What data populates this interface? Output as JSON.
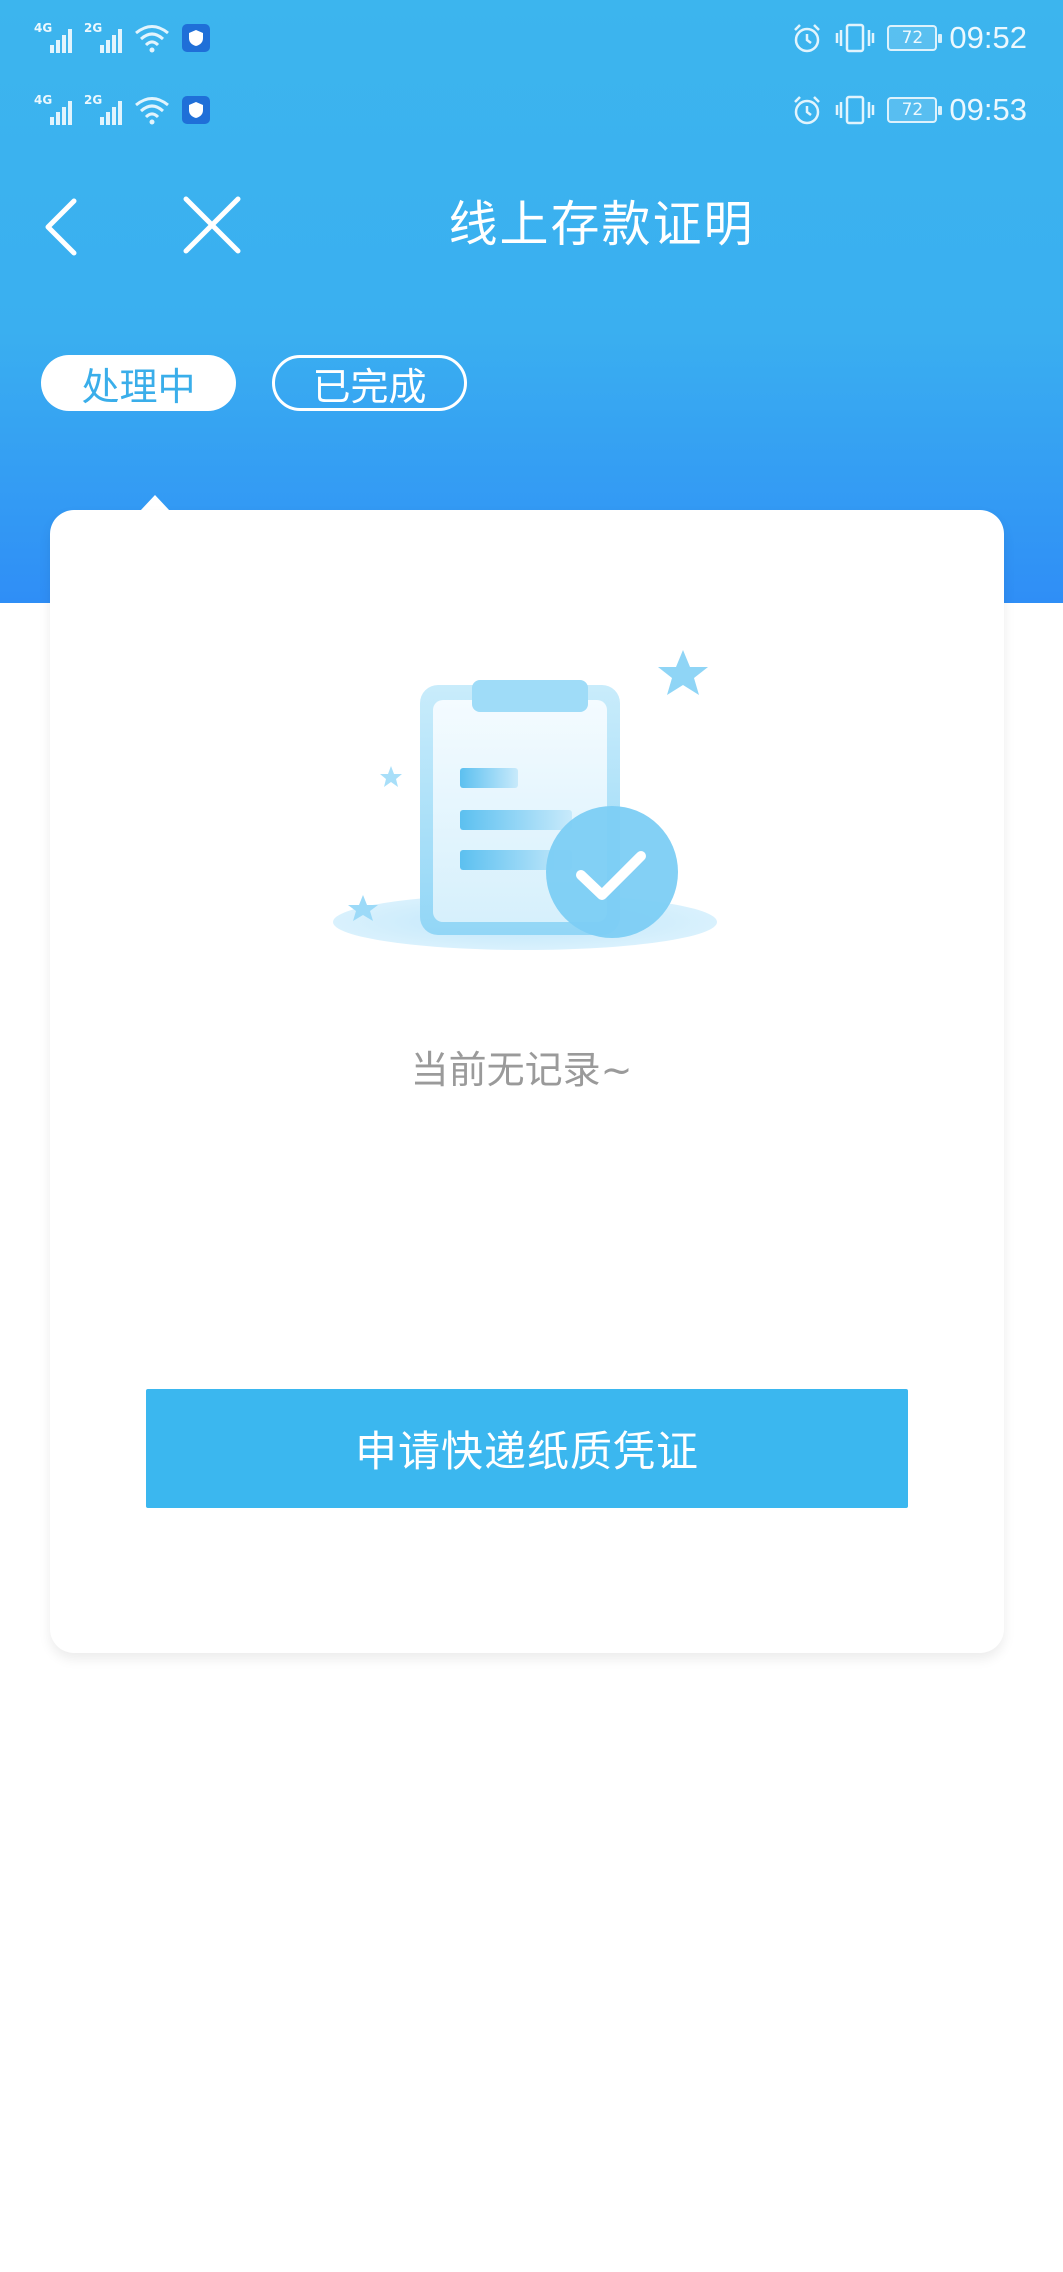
{
  "status_bar_1": {
    "network_1": "4G",
    "network_2": "2G",
    "battery": "72",
    "time": "09:52"
  },
  "status_bar_2": {
    "network_1": "4G",
    "network_2": "2G",
    "battery": "72",
    "time": "09:53"
  },
  "header": {
    "title": "线上存款证明",
    "back_icon": "chevron-left-icon",
    "close_icon": "close-icon"
  },
  "tabs": [
    {
      "label": "处理中",
      "active": true
    },
    {
      "label": "已完成",
      "active": false
    }
  ],
  "empty_state": {
    "icon": "clipboard-check-icon",
    "message": "当前无记录~"
  },
  "actions": {
    "primary_label": "申请快递纸质凭证"
  },
  "colors": {
    "header_top": "#3cb5ee",
    "header_bottom": "#2f8ef6",
    "accent": "#3bb7ef",
    "muted_text": "#9a9a9a"
  }
}
